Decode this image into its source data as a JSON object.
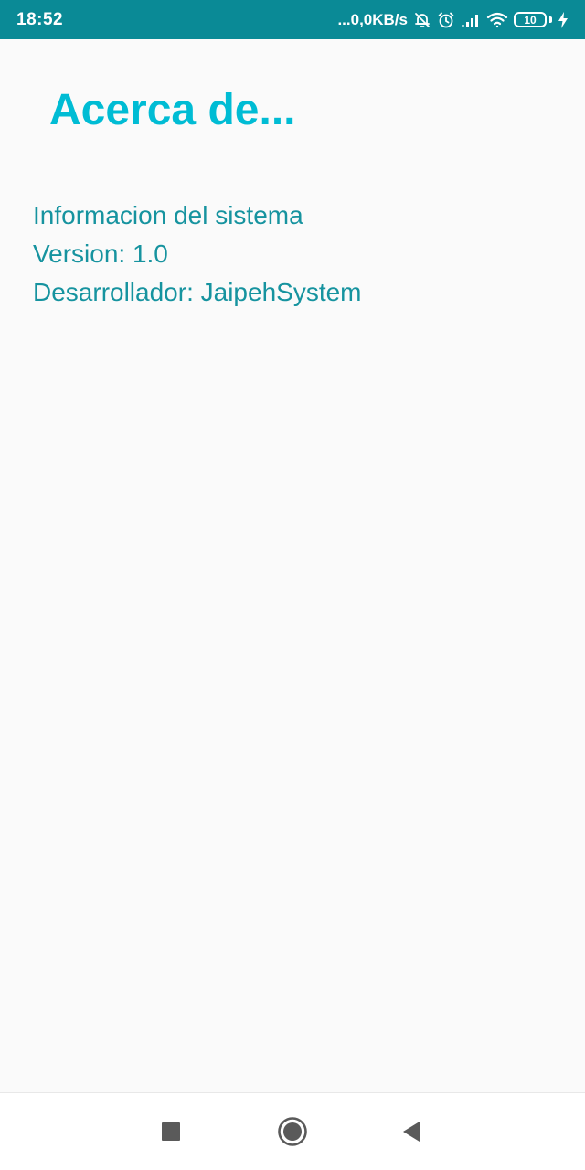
{
  "status_bar": {
    "time": "18:52",
    "network_speed": "...0,0KB/s",
    "battery_level": "10",
    "icons": [
      "bell-off-icon",
      "alarm-icon",
      "signal-icon",
      "wifi-icon",
      "battery-icon",
      "charging-icon"
    ],
    "background_color": "#0a8a96"
  },
  "page": {
    "title": "Acerca de...",
    "title_color": "#00bcd4",
    "text_color": "#16939f",
    "info_lines": [
      "Informacion del sistema",
      "Version: 1.0",
      "Desarrollador: JaipehSystem"
    ]
  },
  "nav_bar": {
    "buttons": [
      "recents",
      "home",
      "back"
    ],
    "icons": [
      "square-icon",
      "circle-icon",
      "triangle-back-icon"
    ]
  }
}
